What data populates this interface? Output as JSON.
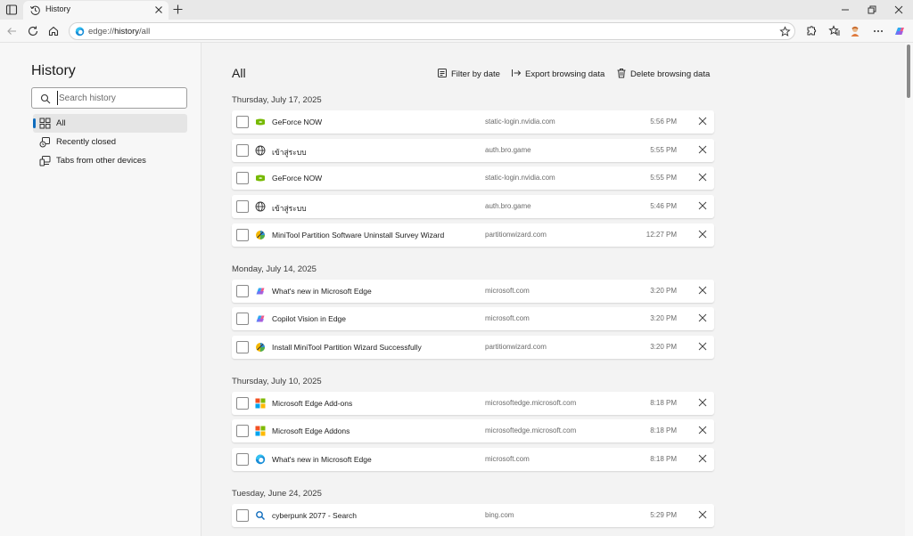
{
  "tab": {
    "title": "History"
  },
  "address": {
    "scheme": "edge://",
    "host": "history",
    "path": "/all"
  },
  "sidebar": {
    "title": "History",
    "search_placeholder": "Search history",
    "items": [
      {
        "label": "All",
        "icon": "grid-icon",
        "active": true
      },
      {
        "label": "Recently closed",
        "icon": "recently-closed-icon",
        "active": false
      },
      {
        "label": "Tabs from other devices",
        "icon": "devices-icon",
        "active": false
      }
    ]
  },
  "main": {
    "title": "All",
    "actions": {
      "filter": "Filter by date",
      "export": "Export browsing data",
      "delete": "Delete browsing data"
    },
    "groups": [
      {
        "date": "Thursday, July 17, 2025",
        "items": [
          {
            "title": "GeForce NOW",
            "domain": "static-login.nvidia.com",
            "time": "5:56 PM",
            "icon": "nvidia-icon"
          },
          {
            "title": "เข้าสู่ระบบ",
            "domain": "auth.bro.game",
            "time": "5:55 PM",
            "icon": "globe-icon"
          },
          {
            "title": "GeForce NOW",
            "domain": "static-login.nvidia.com",
            "time": "5:55 PM",
            "icon": "nvidia-icon"
          },
          {
            "title": "เข้าสู่ระบบ",
            "domain": "auth.bro.game",
            "time": "5:46 PM",
            "icon": "globe-icon"
          },
          {
            "title": "MiniTool Partition Software Uninstall Survey Wizard",
            "domain": "partitionwizard.com",
            "time": "12:27 PM",
            "icon": "minitool-icon"
          }
        ]
      },
      {
        "date": "Monday, July 14, 2025",
        "items": [
          {
            "title": "What's new in Microsoft Edge",
            "domain": "microsoft.com",
            "time": "3:20 PM",
            "icon": "copilot-icon"
          },
          {
            "title": "Copilot Vision in Edge",
            "domain": "microsoft.com",
            "time": "3:20 PM",
            "icon": "copilot-icon"
          },
          {
            "title": "Install MiniTool Partition Wizard Successfully",
            "domain": "partitionwizard.com",
            "time": "3:20 PM",
            "icon": "minitool-icon"
          }
        ]
      },
      {
        "date": "Thursday, July 10, 2025",
        "items": [
          {
            "title": "Microsoft Edge Add-ons",
            "domain": "microsoftedge.microsoft.com",
            "time": "8:18 PM",
            "icon": "microsoft-logo-icon"
          },
          {
            "title": "Microsoft Edge Addons",
            "domain": "microsoftedge.microsoft.com",
            "time": "8:18 PM",
            "icon": "microsoft-logo-icon"
          },
          {
            "title": "What's new in Microsoft Edge",
            "domain": "microsoft.com",
            "time": "8:18 PM",
            "icon": "edge-icon"
          }
        ]
      },
      {
        "date": "Tuesday, June 24, 2025",
        "items": [
          {
            "title": "cyberpunk 2077 - Search",
            "domain": "bing.com",
            "time": "5:29 PM",
            "icon": "bing-search-icon"
          }
        ]
      }
    ]
  }
}
